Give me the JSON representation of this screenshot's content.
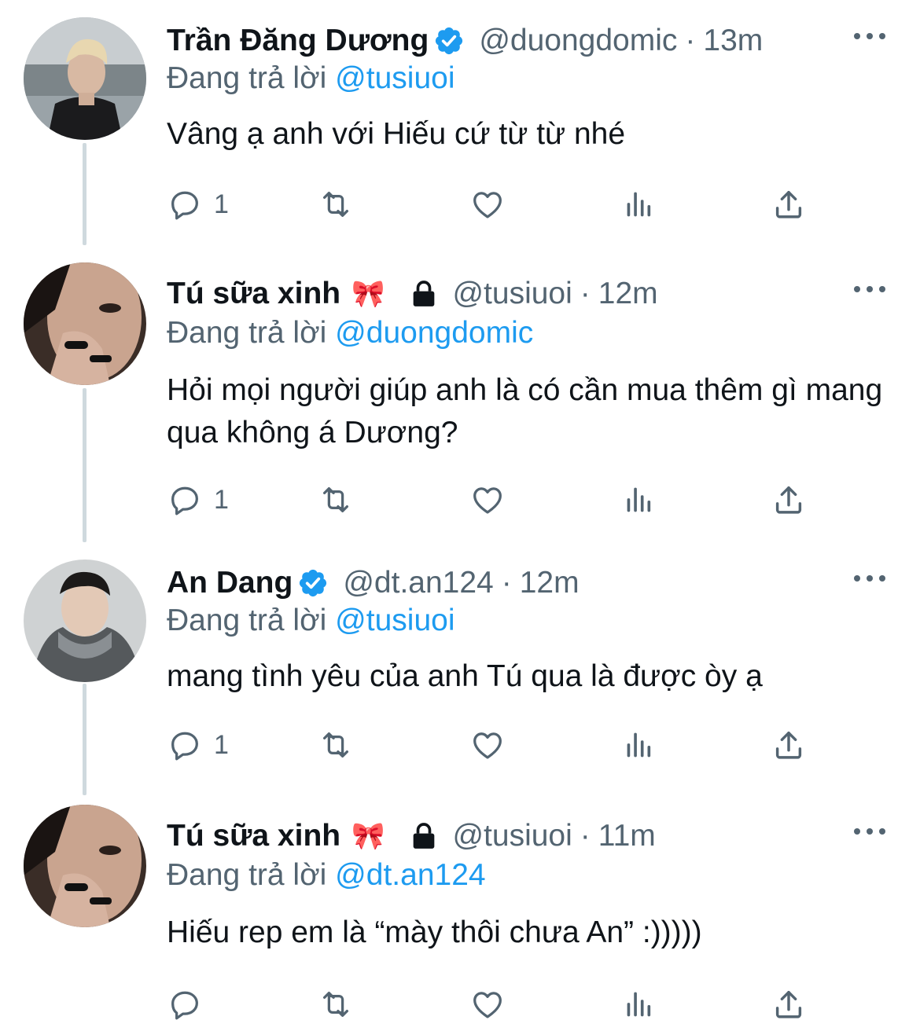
{
  "colors": {
    "text": "#0f1419",
    "secondary": "#536471",
    "link": "#1d9bf0",
    "verified": "#1d9bf0",
    "thread_line": "#cfd9de"
  },
  "tweets": [
    {
      "name": "Trần Đăng Dương",
      "verified": true,
      "protected": false,
      "handle": "@duongdomic",
      "separator": "·",
      "time": "13m",
      "reply_prefix": "Đang trả lời",
      "reply_mention": "@tusiuoi",
      "text": "Vâng ạ anh với Hiếu cứ từ từ nhé",
      "reply_count": "1",
      "avatar_icon": "avatar-photo-man-blond-jacket"
    },
    {
      "name": "Tú sữa xinh",
      "verified": false,
      "protected": true,
      "emoji": "🎀",
      "handle": "@tusiuoi",
      "separator": "·",
      "time": "12m",
      "reply_prefix": "Đang trả lời",
      "reply_mention": "@duongdomic",
      "text": "Hỏi mọi người giúp anh là có cần mua thêm gì mang qua không á Dương?",
      "reply_count": "1",
      "avatar_icon": "avatar-photo-face-rings"
    },
    {
      "name": "An Dang",
      "verified": true,
      "protected": false,
      "handle": "@dt.an124",
      "separator": "·",
      "time": "12m",
      "reply_prefix": "Đang trả lời",
      "reply_mention": "@tusiuoi",
      "text": "mang tình yêu của anh Tú qua là được òy ạ",
      "reply_count": "1",
      "avatar_icon": "avatar-photo-man-grey-scarf"
    },
    {
      "name": "Tú sữa xinh",
      "verified": false,
      "protected": true,
      "emoji": "🎀",
      "handle": "@tusiuoi",
      "separator": "·",
      "time": "11m",
      "reply_prefix": "Đang trả lời",
      "reply_mention": "@dt.an124",
      "text": "Hiếu rep em là “mày thôi chưa An” :)))))",
      "reply_count": "",
      "avatar_icon": "avatar-photo-face-rings"
    }
  ],
  "icons": {
    "reply": "reply-bubble-icon",
    "retweet": "retweet-icon",
    "like": "heart-icon",
    "analytics": "analytics-icon",
    "share": "share-icon",
    "more": "more-dots-icon",
    "verified": "verified-badge-icon",
    "lock": "lock-icon"
  }
}
